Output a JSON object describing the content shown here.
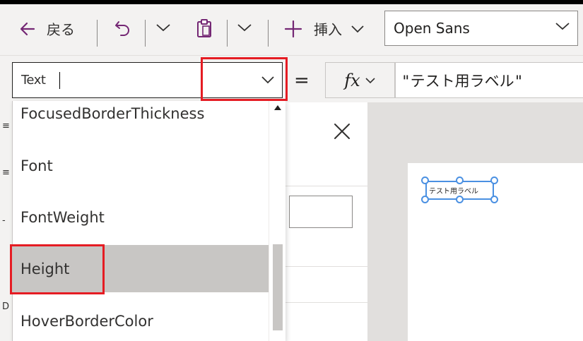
{
  "toolbar": {
    "back_label": "戻る",
    "insert_label": "挿入",
    "font_value": "Open Sans"
  },
  "formula_bar": {
    "property_value": "Text",
    "equals": "=",
    "fx_label": "fx",
    "formula_value": "\"テスト用ラベル\""
  },
  "dropdown": {
    "items": [
      {
        "label": "FocusedBorderThickness"
      },
      {
        "label": "Font"
      },
      {
        "label": "FontWeight"
      },
      {
        "label": "Height"
      },
      {
        "label": "HoverBorderColor"
      }
    ],
    "selected_index": 3
  },
  "canvas": {
    "label_text": "テスト用ラベル"
  },
  "colors": {
    "accent": "#742774",
    "highlight": "#e51c23",
    "selection": "#4a90e2",
    "selected_row": "#c8c6c4"
  },
  "icons": [
    "arrow-left-icon",
    "undo-icon",
    "chevron-down-icon",
    "paste-icon",
    "plus-icon",
    "close-icon",
    "scroll-up-icon"
  ]
}
